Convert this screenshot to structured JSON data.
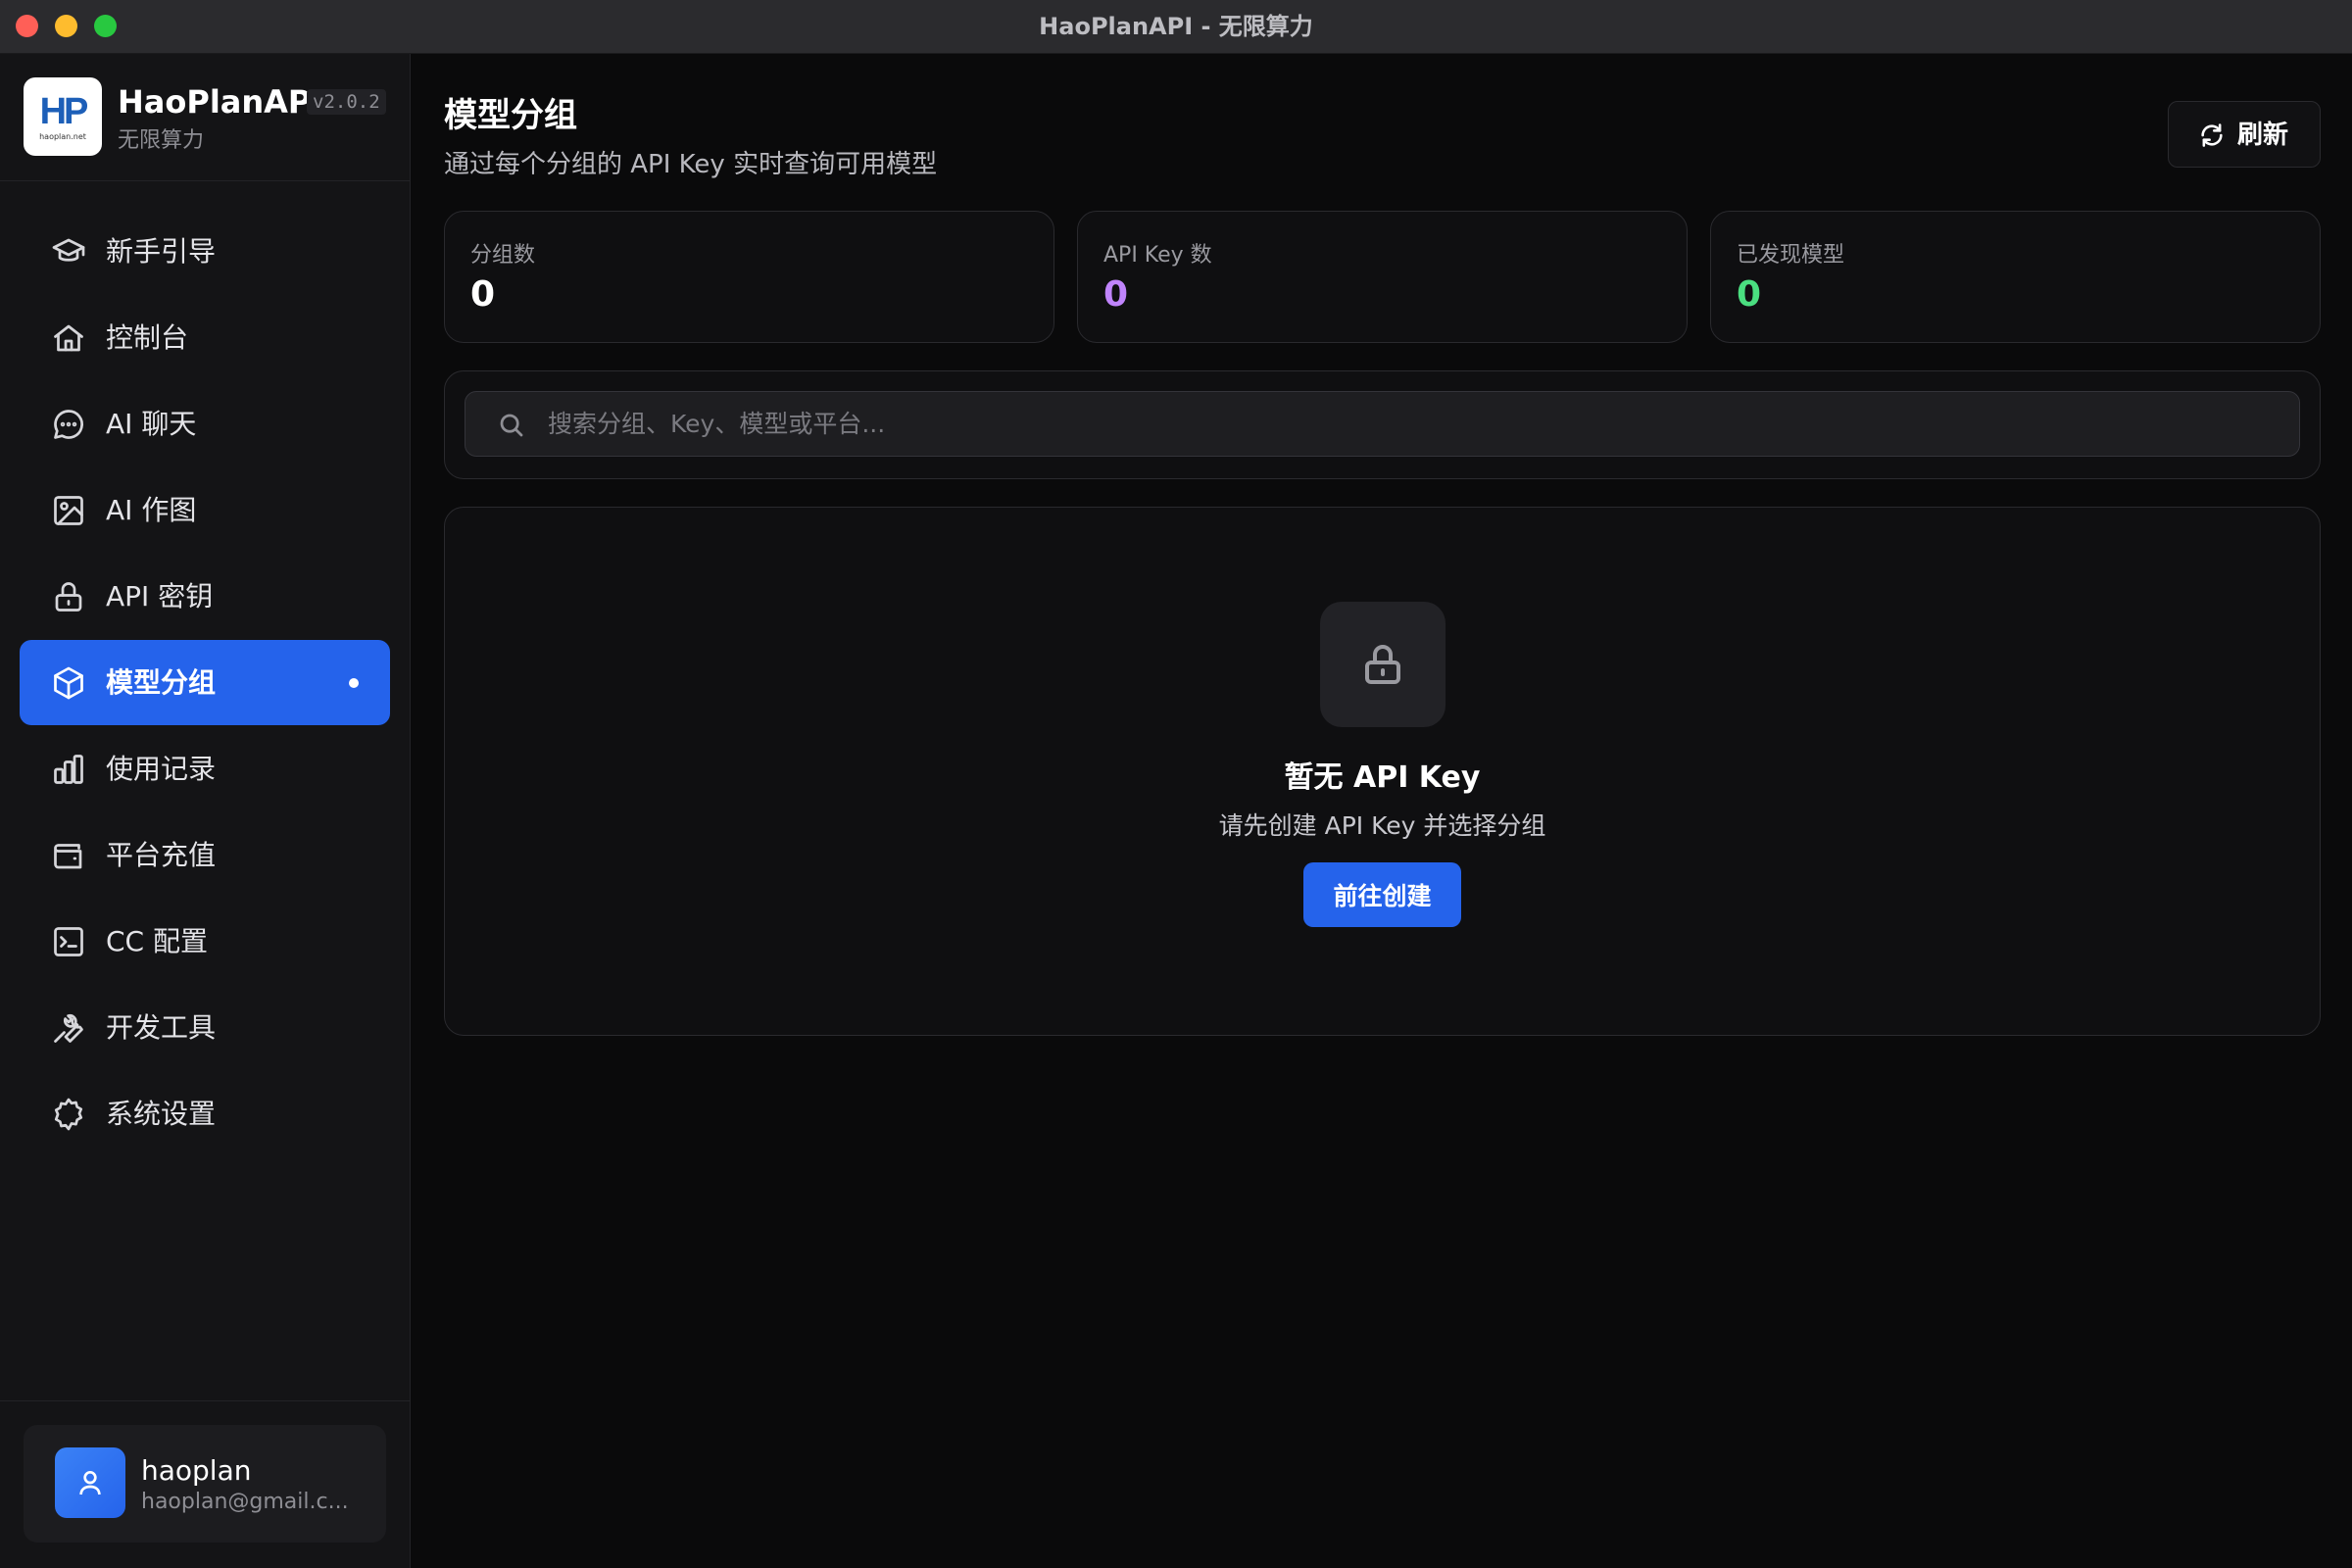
{
  "window": {
    "title": "HaoPlanAPI - 无限算力"
  },
  "brand": {
    "logo_text": "HP",
    "logo_sub": "haoplan.net",
    "name": "HaoPlanAPI",
    "version": "v2.0.2",
    "tagline": "无限算力"
  },
  "sidebar": {
    "items": [
      {
        "label": "新手引导",
        "icon": "graduation-cap-icon"
      },
      {
        "label": "控制台",
        "icon": "home-icon"
      },
      {
        "label": "AI 聊天",
        "icon": "chat-bubble-icon"
      },
      {
        "label": "AI 作图",
        "icon": "image-icon"
      },
      {
        "label": "API 密钥",
        "icon": "lock-icon"
      },
      {
        "label": "模型分组",
        "icon": "box-icon",
        "active": true
      },
      {
        "label": "使用记录",
        "icon": "bar-chart-icon"
      },
      {
        "label": "平台充值",
        "icon": "wallet-icon"
      },
      {
        "label": "CC 配置",
        "icon": "terminal-icon"
      },
      {
        "label": "开发工具",
        "icon": "wrench-icon"
      },
      {
        "label": "系统设置",
        "icon": "gear-icon"
      }
    ],
    "accent_color": "#2563eb"
  },
  "user": {
    "name": "haoplan",
    "email": "haoplan@gmail.c..."
  },
  "page": {
    "title": "模型分组",
    "subtitle": "通过每个分组的 API Key 实时查询可用模型",
    "refresh_label": "刷新"
  },
  "stats": [
    {
      "label": "分组数",
      "value": "0",
      "color": "#ffffff"
    },
    {
      "label": "API Key 数",
      "value": "0",
      "color": "#c084fc"
    },
    {
      "label": "已发现模型",
      "value": "0",
      "color": "#4ade80"
    }
  ],
  "search": {
    "placeholder": "搜索分组、Key、模型或平台...",
    "value": ""
  },
  "empty_state": {
    "title": "暂无 API Key",
    "description": "请先创建 API Key 并选择分组",
    "button_label": "前往创建"
  }
}
